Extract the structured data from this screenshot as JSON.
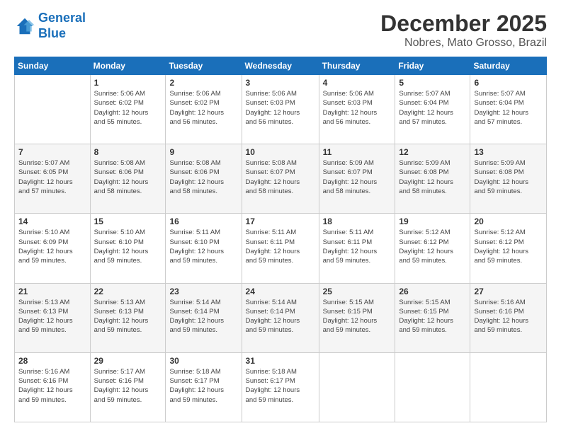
{
  "logo": {
    "line1": "General",
    "line2": "Blue"
  },
  "header": {
    "title": "December 2025",
    "subtitle": "Nobres, Mato Grosso, Brazil"
  },
  "weekdays": [
    "Sunday",
    "Monday",
    "Tuesday",
    "Wednesday",
    "Thursday",
    "Friday",
    "Saturday"
  ],
  "weeks": [
    [
      {
        "day": "",
        "info": ""
      },
      {
        "day": "1",
        "info": "Sunrise: 5:06 AM\nSunset: 6:02 PM\nDaylight: 12 hours\nand 55 minutes."
      },
      {
        "day": "2",
        "info": "Sunrise: 5:06 AM\nSunset: 6:02 PM\nDaylight: 12 hours\nand 56 minutes."
      },
      {
        "day": "3",
        "info": "Sunrise: 5:06 AM\nSunset: 6:03 PM\nDaylight: 12 hours\nand 56 minutes."
      },
      {
        "day": "4",
        "info": "Sunrise: 5:06 AM\nSunset: 6:03 PM\nDaylight: 12 hours\nand 56 minutes."
      },
      {
        "day": "5",
        "info": "Sunrise: 5:07 AM\nSunset: 6:04 PM\nDaylight: 12 hours\nand 57 minutes."
      },
      {
        "day": "6",
        "info": "Sunrise: 5:07 AM\nSunset: 6:04 PM\nDaylight: 12 hours\nand 57 minutes."
      }
    ],
    [
      {
        "day": "7",
        "info": "Sunrise: 5:07 AM\nSunset: 6:05 PM\nDaylight: 12 hours\nand 57 minutes."
      },
      {
        "day": "8",
        "info": "Sunrise: 5:08 AM\nSunset: 6:06 PM\nDaylight: 12 hours\nand 58 minutes."
      },
      {
        "day": "9",
        "info": "Sunrise: 5:08 AM\nSunset: 6:06 PM\nDaylight: 12 hours\nand 58 minutes."
      },
      {
        "day": "10",
        "info": "Sunrise: 5:08 AM\nSunset: 6:07 PM\nDaylight: 12 hours\nand 58 minutes."
      },
      {
        "day": "11",
        "info": "Sunrise: 5:09 AM\nSunset: 6:07 PM\nDaylight: 12 hours\nand 58 minutes."
      },
      {
        "day": "12",
        "info": "Sunrise: 5:09 AM\nSunset: 6:08 PM\nDaylight: 12 hours\nand 58 minutes."
      },
      {
        "day": "13",
        "info": "Sunrise: 5:09 AM\nSunset: 6:08 PM\nDaylight: 12 hours\nand 59 minutes."
      }
    ],
    [
      {
        "day": "14",
        "info": "Sunrise: 5:10 AM\nSunset: 6:09 PM\nDaylight: 12 hours\nand 59 minutes."
      },
      {
        "day": "15",
        "info": "Sunrise: 5:10 AM\nSunset: 6:10 PM\nDaylight: 12 hours\nand 59 minutes."
      },
      {
        "day": "16",
        "info": "Sunrise: 5:11 AM\nSunset: 6:10 PM\nDaylight: 12 hours\nand 59 minutes."
      },
      {
        "day": "17",
        "info": "Sunrise: 5:11 AM\nSunset: 6:11 PM\nDaylight: 12 hours\nand 59 minutes."
      },
      {
        "day": "18",
        "info": "Sunrise: 5:11 AM\nSunset: 6:11 PM\nDaylight: 12 hours\nand 59 minutes."
      },
      {
        "day": "19",
        "info": "Sunrise: 5:12 AM\nSunset: 6:12 PM\nDaylight: 12 hours\nand 59 minutes."
      },
      {
        "day": "20",
        "info": "Sunrise: 5:12 AM\nSunset: 6:12 PM\nDaylight: 12 hours\nand 59 minutes."
      }
    ],
    [
      {
        "day": "21",
        "info": "Sunrise: 5:13 AM\nSunset: 6:13 PM\nDaylight: 12 hours\nand 59 minutes."
      },
      {
        "day": "22",
        "info": "Sunrise: 5:13 AM\nSunset: 6:13 PM\nDaylight: 12 hours\nand 59 minutes."
      },
      {
        "day": "23",
        "info": "Sunrise: 5:14 AM\nSunset: 6:14 PM\nDaylight: 12 hours\nand 59 minutes."
      },
      {
        "day": "24",
        "info": "Sunrise: 5:14 AM\nSunset: 6:14 PM\nDaylight: 12 hours\nand 59 minutes."
      },
      {
        "day": "25",
        "info": "Sunrise: 5:15 AM\nSunset: 6:15 PM\nDaylight: 12 hours\nand 59 minutes."
      },
      {
        "day": "26",
        "info": "Sunrise: 5:15 AM\nSunset: 6:15 PM\nDaylight: 12 hours\nand 59 minutes."
      },
      {
        "day": "27",
        "info": "Sunrise: 5:16 AM\nSunset: 6:16 PM\nDaylight: 12 hours\nand 59 minutes."
      }
    ],
    [
      {
        "day": "28",
        "info": "Sunrise: 5:16 AM\nSunset: 6:16 PM\nDaylight: 12 hours\nand 59 minutes."
      },
      {
        "day": "29",
        "info": "Sunrise: 5:17 AM\nSunset: 6:16 PM\nDaylight: 12 hours\nand 59 minutes."
      },
      {
        "day": "30",
        "info": "Sunrise: 5:18 AM\nSunset: 6:17 PM\nDaylight: 12 hours\nand 59 minutes."
      },
      {
        "day": "31",
        "info": "Sunrise: 5:18 AM\nSunset: 6:17 PM\nDaylight: 12 hours\nand 59 minutes."
      },
      {
        "day": "",
        "info": ""
      },
      {
        "day": "",
        "info": ""
      },
      {
        "day": "",
        "info": ""
      }
    ]
  ]
}
